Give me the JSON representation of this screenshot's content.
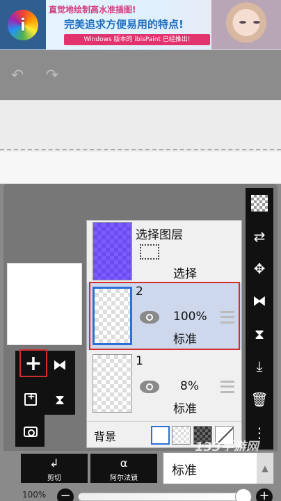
{
  "banner": {
    "logo_letter": "i",
    "line1": "直觉地绘制高水准插图!",
    "line2": "完美追求方便易用的特点!",
    "line3": "Windows 版本的 ibisPaint 已经推出!"
  },
  "toolbar": {
    "undo_icon": "↶",
    "redo_icon": "↷"
  },
  "left_tools": {
    "add_layer_icon": "+",
    "flip_icon": "⧓",
    "merge_icon": "⧗"
  },
  "layers": {
    "selection": {
      "title": "选择图层",
      "label": "选择"
    },
    "layer2": {
      "number": "2",
      "opacity": "100%",
      "blend": "标准"
    },
    "layer1": {
      "number": "1",
      "opacity": "8%",
      "blend": "标准"
    },
    "background": {
      "label": "背景"
    }
  },
  "right_bar": {
    "move_icon": "✥",
    "flip_icon": "⧓",
    "rotate_icon": "⧗",
    "merge_down_icon": "⤓",
    "trash_icon": "🗑",
    "more_icon": "⋮",
    "swap_icon": "⇄"
  },
  "bottom": {
    "clip_icon": "↲",
    "clip_label": "剪切",
    "alpha_icon": "α",
    "alpha_label": "阿尔法锁",
    "blend_value": "标准",
    "blend_arrow": "▲",
    "opacity_label": "100%",
    "minus": "−",
    "plus": "+"
  },
  "watermark": "133手游网"
}
